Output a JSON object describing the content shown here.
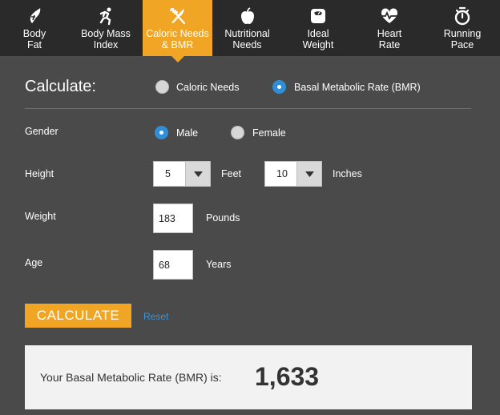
{
  "tabs": [
    {
      "label": "Body\nFat",
      "icon": "body-fat-icon"
    },
    {
      "label": "Body Mass\nIndex",
      "icon": "running-figure-icon"
    },
    {
      "label": "Caloric Needs\n& BMR",
      "icon": "fork-knife-icon",
      "active": true
    },
    {
      "label": "Nutritional\nNeeds",
      "icon": "apple-icon"
    },
    {
      "label": "Ideal\nWeight",
      "icon": "scale-icon"
    },
    {
      "label": "Heart\nRate",
      "icon": "heart-rate-icon"
    },
    {
      "label": "Running\nPace",
      "icon": "stopwatch-icon"
    }
  ],
  "calculate": {
    "title": "Calculate:",
    "options": [
      "Caloric Needs",
      "Basal Metabolic Rate (BMR)"
    ],
    "selected": "Basal Metabolic Rate (BMR)"
  },
  "gender": {
    "label": "Gender",
    "options": [
      "Male",
      "Female"
    ],
    "selected": "Male"
  },
  "height": {
    "label": "Height",
    "feet_value": "5",
    "feet_unit": "Feet",
    "inches_value": "10",
    "inches_unit": "Inches"
  },
  "weight": {
    "label": "Weight",
    "value": "183",
    "unit": "Pounds"
  },
  "age": {
    "label": "Age",
    "value": "68",
    "unit": "Years"
  },
  "buttons": {
    "calculate": "CALCULATE",
    "reset": "Reset"
  },
  "result": {
    "label": "Your Basal Metabolic Rate (BMR) is:",
    "value": "1,633"
  },
  "colors": {
    "accent": "#f0a524",
    "tabbar": "#2a2a2a",
    "panel": "#4a4a4a",
    "radio_on": "#2e8fd6",
    "link": "#3a93d8"
  }
}
